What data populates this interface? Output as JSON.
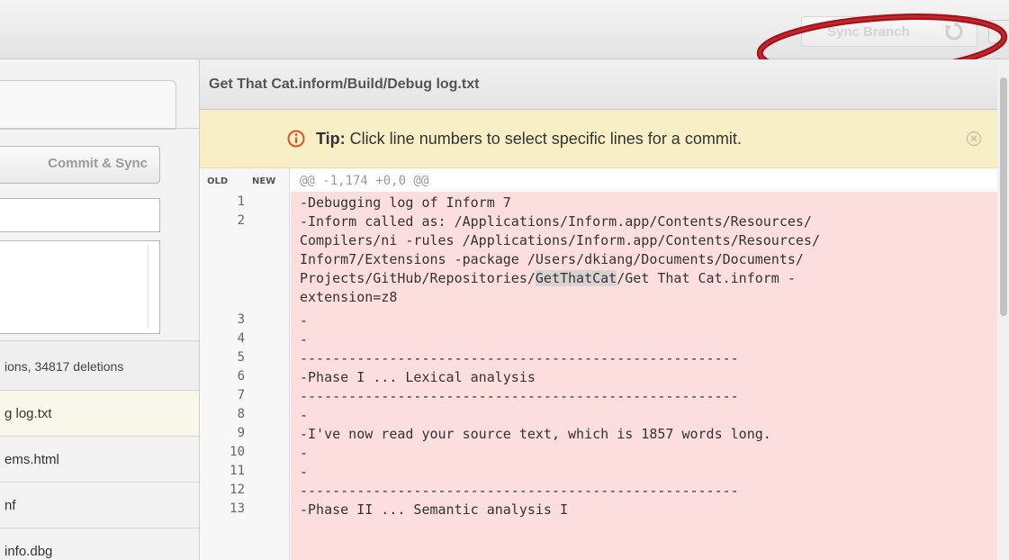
{
  "toolbar": {
    "sync_label": "Sync Branch",
    "sync_icon": "sync-icon"
  },
  "left": {
    "commit_label": "Commit & Sync",
    "stats": "ions, 34817 deletions",
    "files": [
      "g log.txt",
      "ems.html",
      "nf",
      "info.dbg"
    ]
  },
  "diff": {
    "path": "Get That Cat.inform/Build/Debug log.txt",
    "tip_bold": "Tip:",
    "tip_text": " Click line numbers to select specific lines for a commit.",
    "col_old": "OLD",
    "col_new": "NEW",
    "hunk": "@@ -1,174 +0,0 @@",
    "lines": [
      {
        "num": "1",
        "text": "-Debugging log of Inform 7"
      },
      {
        "num": "2",
        "text": "-Inform called as: /Applications/Inform.app/Contents/Resources/"
      },
      {
        "num": "",
        "text": "Compilers/ni -rules /Applications/Inform.app/Contents/Resources/"
      },
      {
        "num": "",
        "text": "Inform7/Extensions -package /Users/dkiang/Documents/Documents/"
      },
      {
        "num": "",
        "text": "Projects/GitHub/Repositories/",
        "hl": "GetThatCat",
        "after": "/Get That Cat.inform -"
      },
      {
        "num": "",
        "text": "extension=z8"
      },
      {
        "num": "3",
        "text": "-"
      },
      {
        "num": "4",
        "text": "-"
      },
      {
        "num": "5",
        "text": "------------------------------------------------------"
      },
      {
        "num": "6",
        "text": "-Phase I ... Lexical analysis"
      },
      {
        "num": "7",
        "text": "------------------------------------------------------"
      },
      {
        "num": "8",
        "text": "-"
      },
      {
        "num": "9",
        "text": "-I've now read your source text, which is 1857 words long."
      },
      {
        "num": "10",
        "text": "-"
      },
      {
        "num": "11",
        "text": "-"
      },
      {
        "num": "12",
        "text": "------------------------------------------------------"
      },
      {
        "num": "13",
        "text": "-Phase II ... Semantic analysis I"
      }
    ]
  },
  "colors": {
    "deletion_bg": "#fddede",
    "tip_bg": "#f8efc6",
    "annotation": "#a3131a"
  }
}
